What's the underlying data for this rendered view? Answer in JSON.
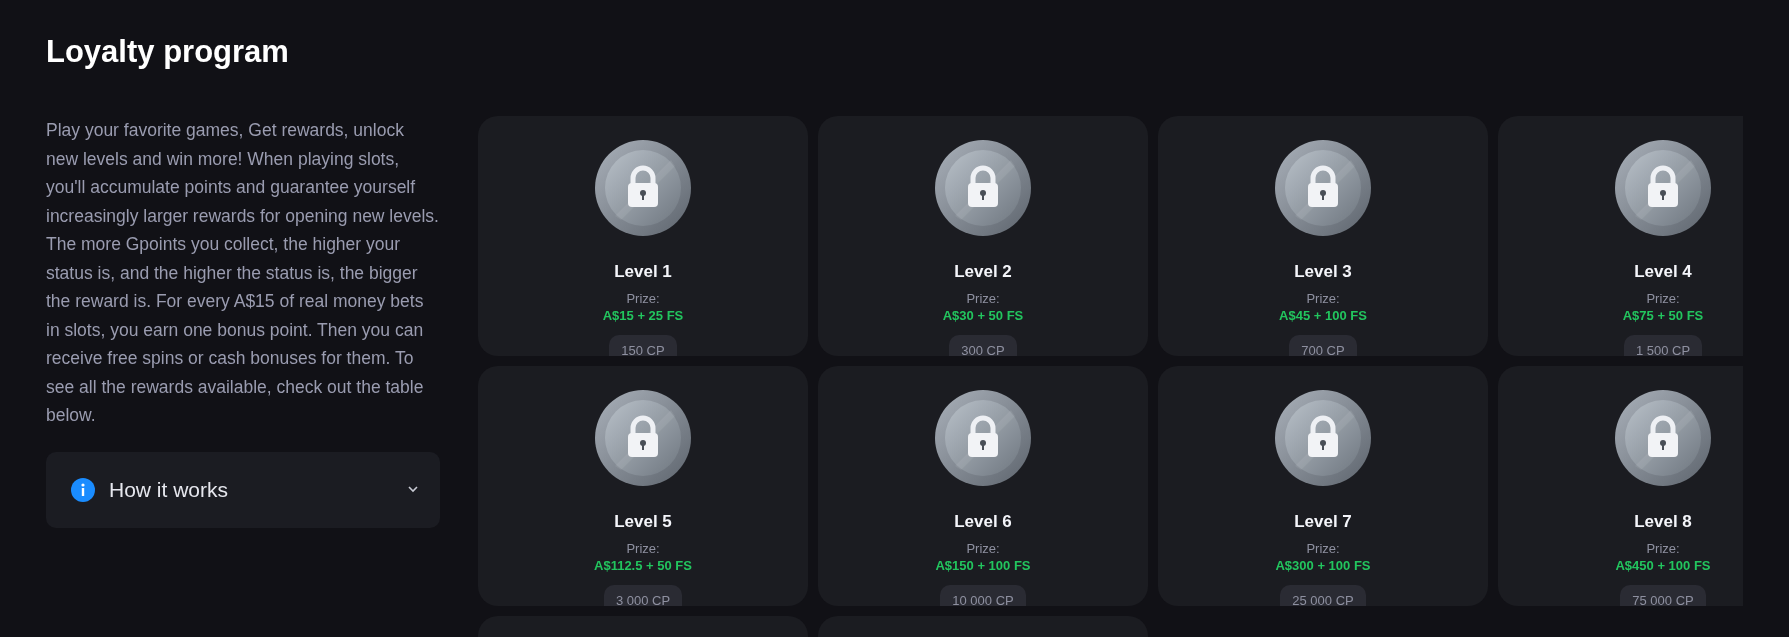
{
  "title": "Loyalty program",
  "description": "Play your favorite games, Get rewards, unlock new levels and win more! When playing slots, you'll accumulate points and guarantee yourself increasingly larger rewards for opening new levels. The more Gpoints you collect, the higher your status is, and the higher the status is, the bigger the reward is. For every A$15 of real money bets in slots, you earn one bonus point. Then you can receive free spins or cash bonuses for them. To see all the rewards available, check out the table below.",
  "how_it_works": {
    "label": "How it works",
    "expanded": false
  },
  "levels": [
    {
      "kind": "level",
      "locked": true,
      "name": "Level 1",
      "prize_label": "Prize:",
      "prize": "A$15 + 25 FS",
      "points": "150 CP"
    },
    {
      "kind": "level",
      "locked": true,
      "name": "Level 2",
      "prize_label": "Prize:",
      "prize": "A$30 + 50 FS",
      "points": "300 CP"
    },
    {
      "kind": "level",
      "locked": true,
      "name": "Level 3",
      "prize_label": "Prize:",
      "prize": "A$45 + 100 FS",
      "points": "700 CP"
    },
    {
      "kind": "level",
      "locked": true,
      "name": "Level 4",
      "prize_label": "Prize:",
      "prize": "A$75 + 50 FS",
      "points": "1 500 CP"
    },
    {
      "kind": "level",
      "locked": true,
      "name": "Level 5",
      "prize_label": "Prize:",
      "prize": "A$112.5 + 50 FS",
      "points": "3 000 CP"
    },
    {
      "kind": "level",
      "locked": true,
      "name": "Level 6",
      "prize_label": "Prize:",
      "prize": "A$150 + 100 FS",
      "points": "10 000 CP"
    },
    {
      "kind": "level",
      "locked": true,
      "name": "Level 7",
      "prize_label": "Prize:",
      "prize": "A$300 + 100 FS",
      "points": "25 000 CP"
    },
    {
      "kind": "level",
      "locked": true,
      "name": "Level 8",
      "prize_label": "Prize:",
      "prize": "A$450 + 100 FS",
      "points": "75 000 CP"
    },
    {
      "kind": "empty"
    },
    {
      "kind": "empty"
    }
  ]
}
